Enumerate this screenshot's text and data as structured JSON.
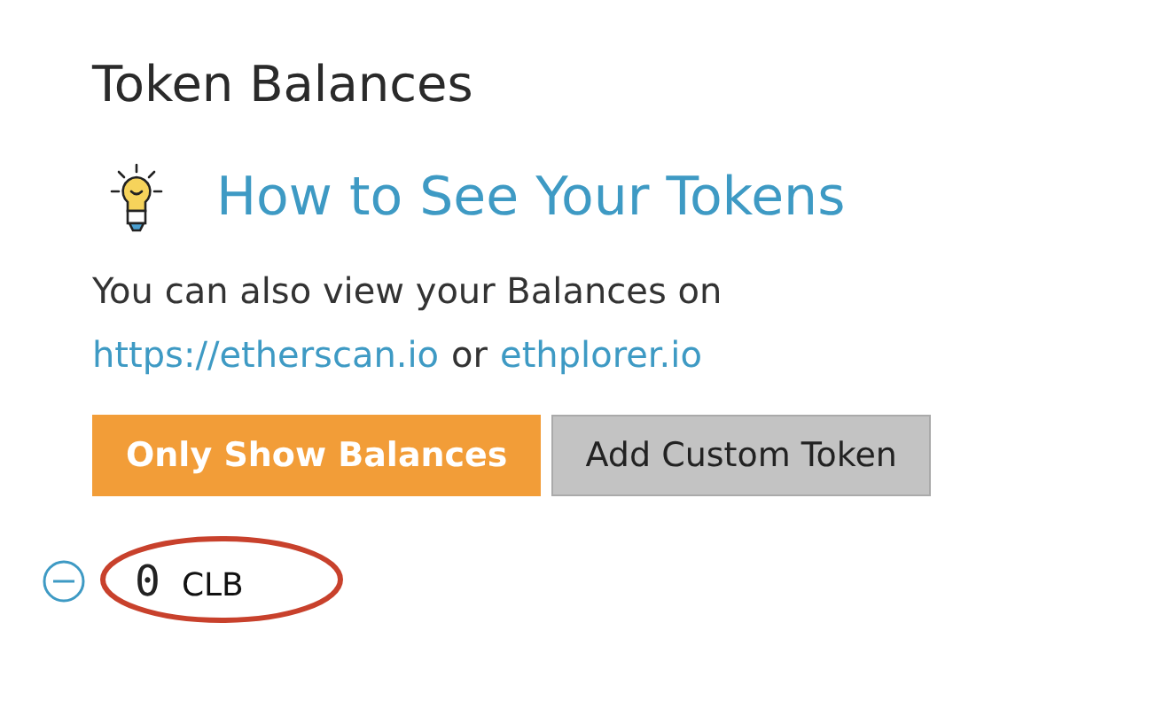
{
  "title": "Token Balances",
  "help": {
    "heading": "How to See Your Tokens",
    "text": "You can also view your Balances on",
    "link_1": "https://etherscan.io",
    "separator": "or",
    "link_2": "ethplorer.io"
  },
  "buttons": [
    {
      "label": "Only Show Balances",
      "kind": "primary"
    },
    {
      "label": "Add Custom Token",
      "kind": "secondary"
    }
  ],
  "tokens": [
    {
      "balance": "0",
      "symbol": "CLB",
      "highlighted": true
    }
  ]
}
